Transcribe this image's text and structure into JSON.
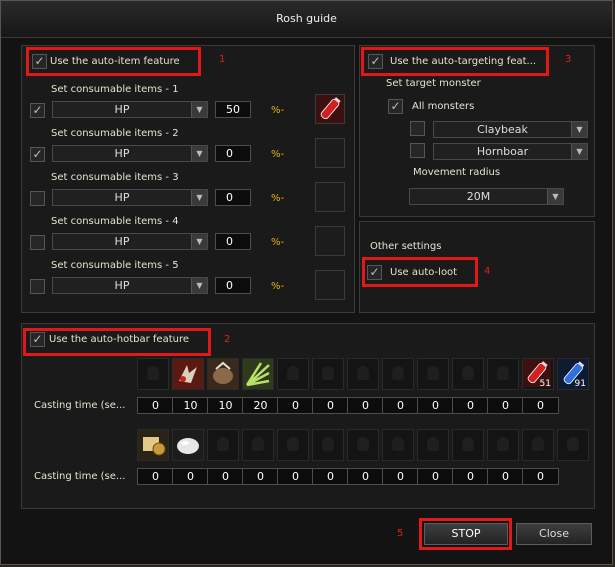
{
  "window": {
    "title": "Rosh guide"
  },
  "auto_item": {
    "feature_label": "Use the auto-item feature",
    "marker": "1",
    "unit": "%-",
    "rows": [
      {
        "label": "Set consumable items - 1",
        "checked": true,
        "type": "HP",
        "value": "50",
        "icon": "red-potion"
      },
      {
        "label": "Set consumable items - 2",
        "checked": true,
        "type": "HP",
        "value": "0",
        "icon": ""
      },
      {
        "label": "Set consumable items - 3",
        "checked": false,
        "type": "HP",
        "value": "0",
        "icon": ""
      },
      {
        "label": "Set consumable items - 4",
        "checked": false,
        "type": "HP",
        "value": "0",
        "icon": ""
      },
      {
        "label": "Set consumable items - 5",
        "checked": false,
        "type": "HP",
        "value": "0",
        "icon": ""
      }
    ]
  },
  "auto_targeting": {
    "feature_label": "Use the auto-targeting feat...",
    "marker": "3",
    "set_target_label": "Set target monster",
    "all_monsters_label": "All monsters",
    "monster_1": "Claybeak",
    "monster_2": "Hornboar",
    "movement_radius_label": "Movement radius",
    "movement_radius": "20M"
  },
  "other_settings": {
    "label": "Other settings",
    "auto_loot_label": "Use auto-loot",
    "marker": "4"
  },
  "auto_hotbar": {
    "feature_label": "Use the auto-hotbar feature",
    "marker": "2",
    "casting_time_label": "Casting time (se...",
    "row1_icons": [
      "",
      "claw-skill-icon",
      "stone-skill-icon",
      "fan-skill-icon",
      "",
      "",
      "",
      "",
      "",
      "",
      "",
      "red-potion-icon",
      "blue-potion-icon"
    ],
    "row1_counts": [
      "",
      "",
      "",
      "",
      "",
      "",
      "",
      "",
      "",
      "",
      "",
      "51",
      "91"
    ],
    "row1_times": [
      "0",
      "10",
      "10",
      "20",
      "0",
      "0",
      "0",
      "0",
      "0",
      "0",
      "0",
      "0"
    ],
    "row2_icons": [
      "scroll-icon",
      "white-orb-icon",
      "",
      "",
      "",
      "",
      "",
      "",
      "",
      "",
      "",
      "",
      ""
    ],
    "row2_times": [
      "0",
      "0",
      "0",
      "0",
      "0",
      "0",
      "0",
      "0",
      "0",
      "0",
      "0",
      "0"
    ]
  },
  "buttons": {
    "stop": "STOP",
    "stop_marker": "5",
    "close": "Close"
  },
  "colors": {
    "highlight": "#e01818",
    "marker_text": "#e12020",
    "percent_text": "#e8b40a"
  }
}
